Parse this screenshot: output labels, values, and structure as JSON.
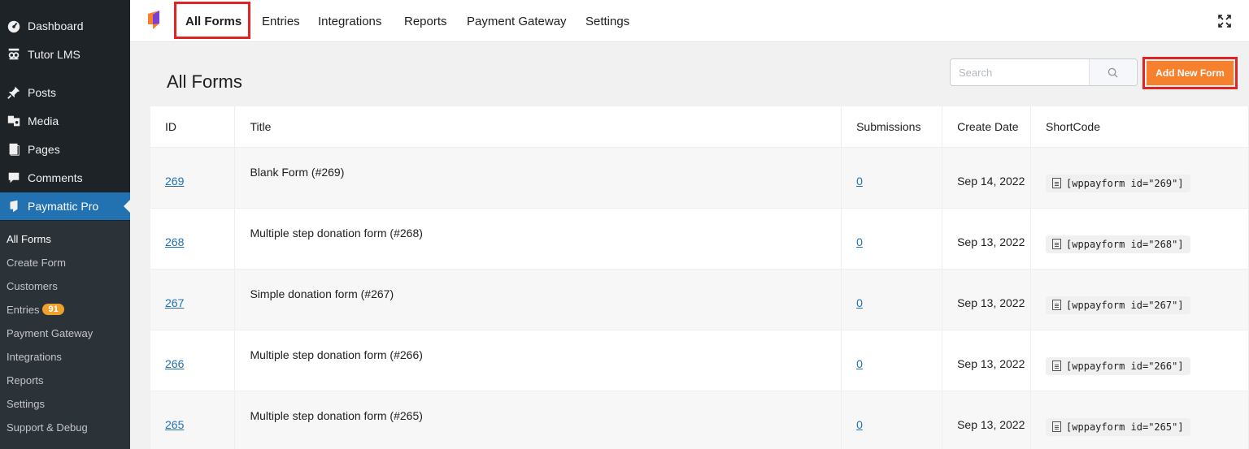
{
  "sidebar": {
    "items": [
      {
        "label": "Dashboard",
        "icon": "dashboard-icon"
      },
      {
        "label": "Tutor LMS",
        "icon": "tutor-icon"
      },
      {
        "label": "Posts",
        "icon": "pin-icon"
      },
      {
        "label": "Media",
        "icon": "media-icon"
      },
      {
        "label": "Pages",
        "icon": "page-icon"
      },
      {
        "label": "Comments",
        "icon": "comment-icon"
      },
      {
        "label": "Paymattic Pro",
        "icon": "paymattic-icon"
      }
    ],
    "submenu": [
      {
        "label": "All Forms"
      },
      {
        "label": "Create Form"
      },
      {
        "label": "Customers"
      },
      {
        "label": "Entries",
        "badge": "91"
      },
      {
        "label": "Payment Gateway"
      },
      {
        "label": "Integrations"
      },
      {
        "label": "Reports"
      },
      {
        "label": "Settings"
      },
      {
        "label": "Support & Debug"
      }
    ]
  },
  "topnav": {
    "tabs": [
      "All Forms",
      "Entries",
      "Integrations",
      "Reports",
      "Payment Gateway",
      "Settings"
    ],
    "active_tab": "All Forms"
  },
  "main": {
    "title": "All Forms",
    "search_placeholder": "Search",
    "add_button": "Add New Form"
  },
  "table": {
    "headers": [
      "ID",
      "Title",
      "Submissions",
      "Create Date",
      "ShortCode"
    ],
    "rows": [
      {
        "id": "269",
        "title": "Blank Form (#269)",
        "submissions": "0",
        "date": "Sep 14, 2022",
        "shortcode": "[wppayform id=\"269\"]"
      },
      {
        "id": "268",
        "title": "Multiple step donation form (#268)",
        "submissions": "0",
        "date": "Sep 13, 2022",
        "shortcode": "[wppayform id=\"268\"]"
      },
      {
        "id": "267",
        "title": "Simple donation form (#267)",
        "submissions": "0",
        "date": "Sep 13, 2022",
        "shortcode": "[wppayform id=\"267\"]"
      },
      {
        "id": "266",
        "title": "Multiple step donation form (#266)",
        "submissions": "0",
        "date": "Sep 13, 2022",
        "shortcode": "[wppayform id=\"266\"]"
      },
      {
        "id": "265",
        "title": "Multiple step donation form (#265)",
        "submissions": "0",
        "date": "Sep 13, 2022",
        "shortcode": "[wppayform id=\"265\"]"
      }
    ]
  },
  "colors": {
    "sidebar_bg": "#1d2327",
    "active_menu": "#2271b1",
    "add_button": "#f6802b",
    "highlight_border": "#e02424",
    "link": "#2271b1"
  }
}
